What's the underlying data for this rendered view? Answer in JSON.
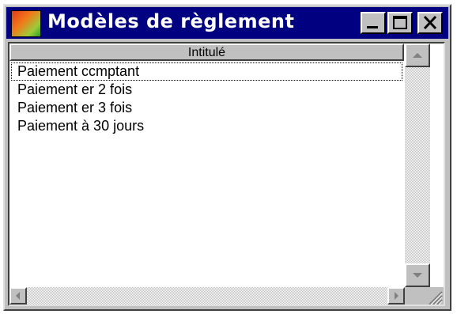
{
  "window": {
    "title": "Modèles de règlement",
    "controls": [
      "minimize",
      "maximize",
      "close"
    ]
  },
  "list": {
    "column_header": "Intitulé",
    "items": [
      {
        "label": "Paiement ccmptant",
        "focused": true
      },
      {
        "label": "Paiement er 2 fois",
        "focused": false
      },
      {
        "label": "Paiement er 3 fois",
        "focused": false
      },
      {
        "label": "Paiement à 30 jours",
        "focused": false
      }
    ]
  },
  "icons": {
    "app": "app-icon",
    "minimize": "minimize-icon",
    "maximize": "maximize-icon",
    "close": "close-icon",
    "scroll_up": "arrow-up-icon",
    "scroll_down": "arrow-down-icon",
    "scroll_left": "arrow-left-icon",
    "scroll_right": "arrow-right-icon",
    "resize": "resize-grip-icon"
  },
  "colors": {
    "titlebar": "#000080",
    "title_text": "#ffffff",
    "face": "#c0c0c0",
    "list_bg": "#ffffff"
  }
}
